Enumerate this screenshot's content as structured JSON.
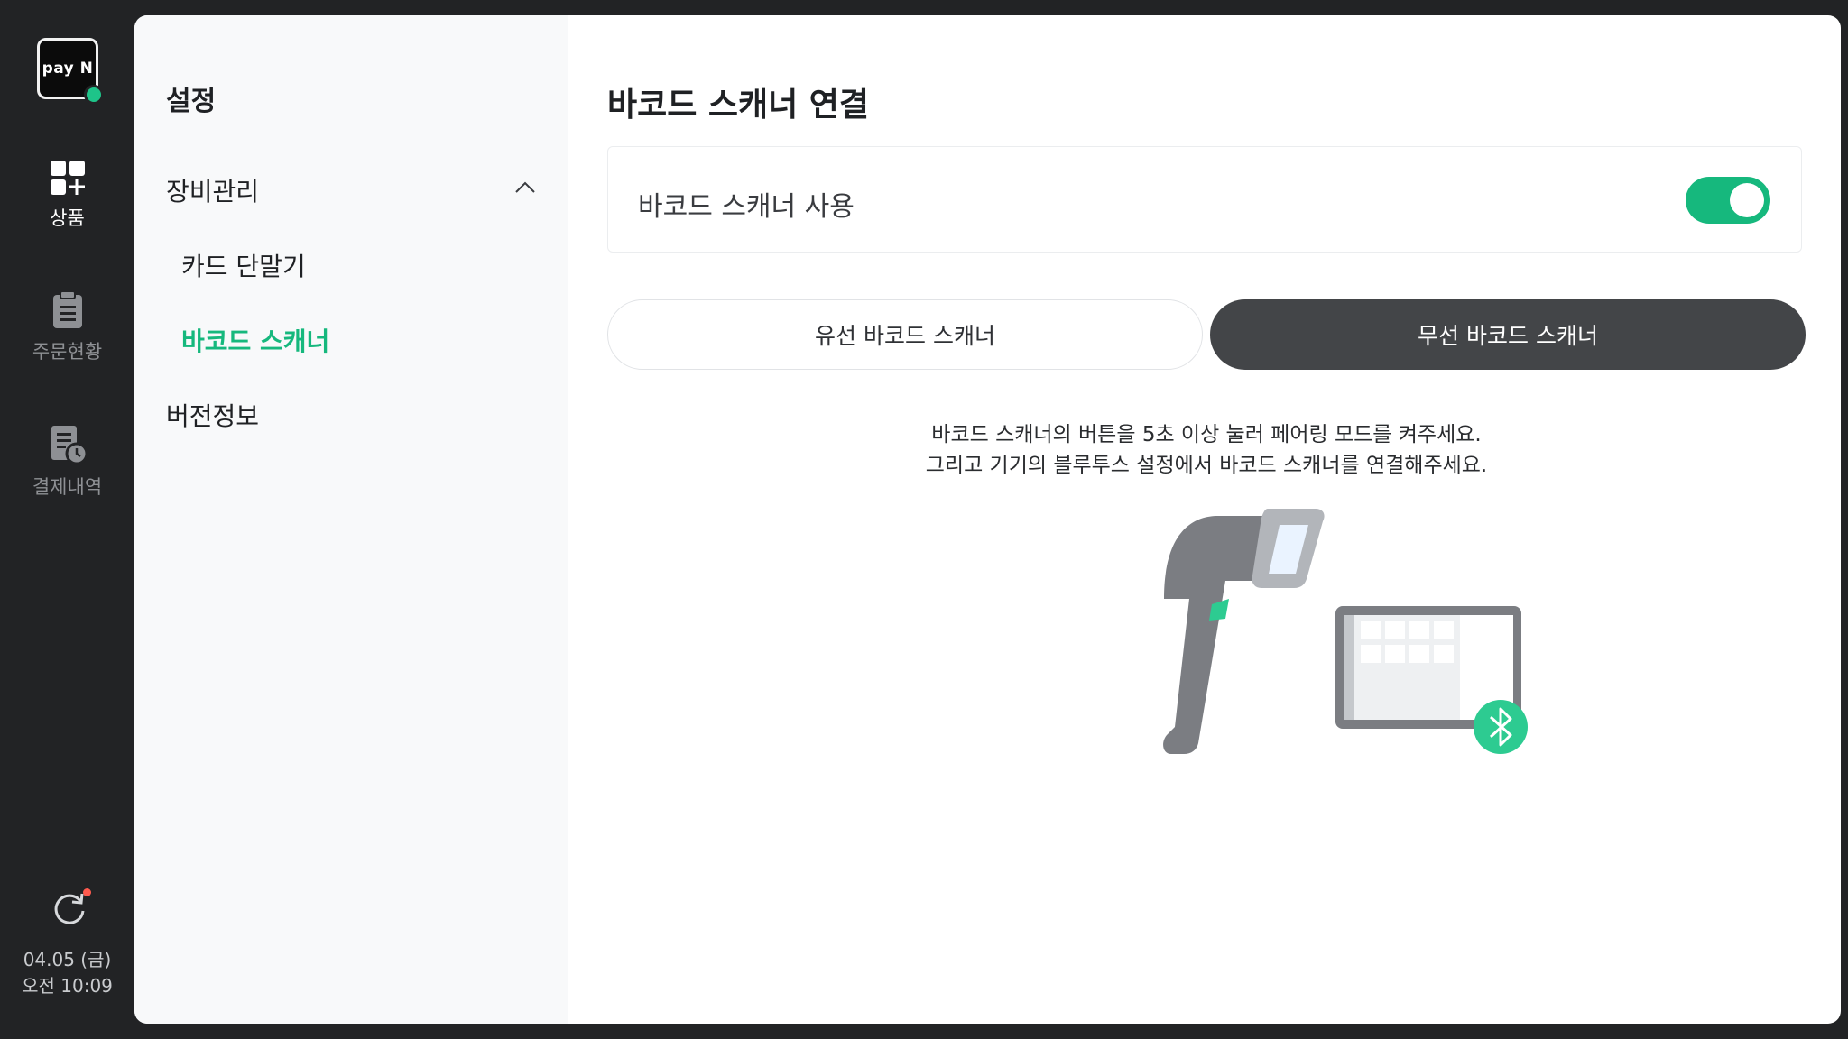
{
  "rail": {
    "logo_text": "pay N",
    "items": [
      {
        "label": "상품",
        "icon": "product-grid-icon"
      },
      {
        "label": "주문현황",
        "icon": "clipboard-icon"
      },
      {
        "label": "결제내역",
        "icon": "receipt-clock-icon"
      }
    ],
    "refresh_icon": "refresh-icon",
    "date": "04.05 (금)",
    "time": "오전 10:09"
  },
  "settings": {
    "title": "설정",
    "group": "장비관리",
    "sub_items": [
      {
        "label": "카드 단말기",
        "active": false
      },
      {
        "label": "바코드 스캐너",
        "active": true
      }
    ],
    "version": "버전정보"
  },
  "content": {
    "title": "바코드 스캐너 연결",
    "toggle_label": "바코드 스캐너 사용",
    "toggle_on": true,
    "tabs": [
      {
        "label": "유선 바코드 스캐너",
        "selected": false
      },
      {
        "label": "무선 바코드 스캐너",
        "selected": true
      }
    ],
    "instruction_1": "바코드 스캐너의 버튼을 5초 이상 눌러 페어링 모드를 켜주세요.",
    "instruction_2": "그리고 기기의 블루투스 설정에서 바코드 스캐너를 연결해주세요."
  },
  "colors": {
    "accent": "#16b87d",
    "rail_bg": "#222325",
    "selected_tab": "#434548"
  }
}
